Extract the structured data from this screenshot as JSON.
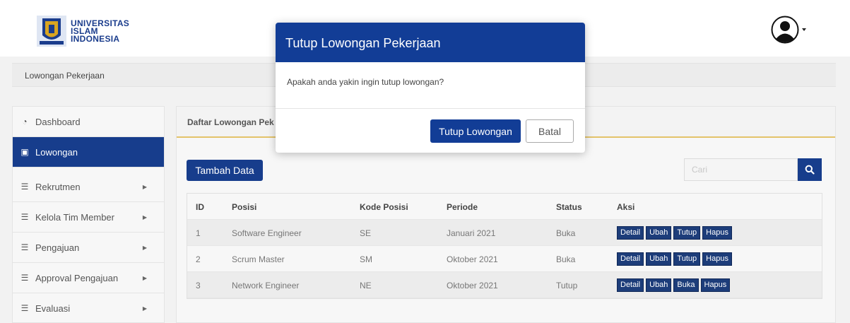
{
  "header": {
    "logo": {
      "line1": "UNIVERSITAS",
      "line2": "ISLAM",
      "line3": "INDONESIA"
    },
    "avatar_icon": "user-avatar-icon"
  },
  "breadcrumb": {
    "label": "Lowongan Pekerjaan"
  },
  "sidebar": {
    "items": [
      {
        "label": "Dashboard",
        "icon": "dashboard-icon",
        "active": false
      },
      {
        "label": "Lowongan",
        "icon": "briefcase-icon",
        "active": true
      },
      {
        "label": "Rekrutmen",
        "icon": "list-icon",
        "active": false
      },
      {
        "label": "Kelola Tim Member",
        "icon": "list-icon",
        "active": false
      },
      {
        "label": "Pengajuan",
        "icon": "list-icon",
        "active": false
      },
      {
        "label": "Approval Pengajuan",
        "icon": "list-icon",
        "active": false
      },
      {
        "label": "Evaluasi",
        "icon": "list-icon",
        "active": false
      }
    ]
  },
  "panel": {
    "title": "Daftar Lowongan Pek",
    "add_label": "Tambah Data",
    "search_placeholder": "Cari",
    "search_icon": "search-icon"
  },
  "table": {
    "headers": [
      "ID",
      "Posisi",
      "Kode Posisi",
      "Periode",
      "Status",
      "Aksi"
    ],
    "rows": [
      {
        "id": "1",
        "posisi": "Software Engineer",
        "kode": "SE",
        "periode": "Januari 2021",
        "status": "Buka",
        "actions": [
          "Detail",
          "Ubah",
          "Tutup",
          "Hapus"
        ]
      },
      {
        "id": "2",
        "posisi": "Scrum Master",
        "kode": "SM",
        "periode": "Oktober 2021",
        "status": "Buka",
        "actions": [
          "Detail",
          "Ubah",
          "Tutup",
          "Hapus"
        ]
      },
      {
        "id": "3",
        "posisi": "Network Engineer",
        "kode": "NE",
        "periode": "Oktober 2021",
        "status": "Tutup",
        "actions": [
          "Detail",
          "Ubah",
          "Buka",
          "Hapus"
        ]
      }
    ]
  },
  "modal": {
    "title": "Tutup Lowongan Pekerjaan",
    "message": "Apakah anda yakin ingin tutup lowongan?",
    "confirm_label": "Tutup Lowongan",
    "cancel_label": "Batal"
  },
  "colors": {
    "primary": "#123d96",
    "sidebar_active": "#173d8c",
    "panel_accent": "#e3c36a"
  }
}
